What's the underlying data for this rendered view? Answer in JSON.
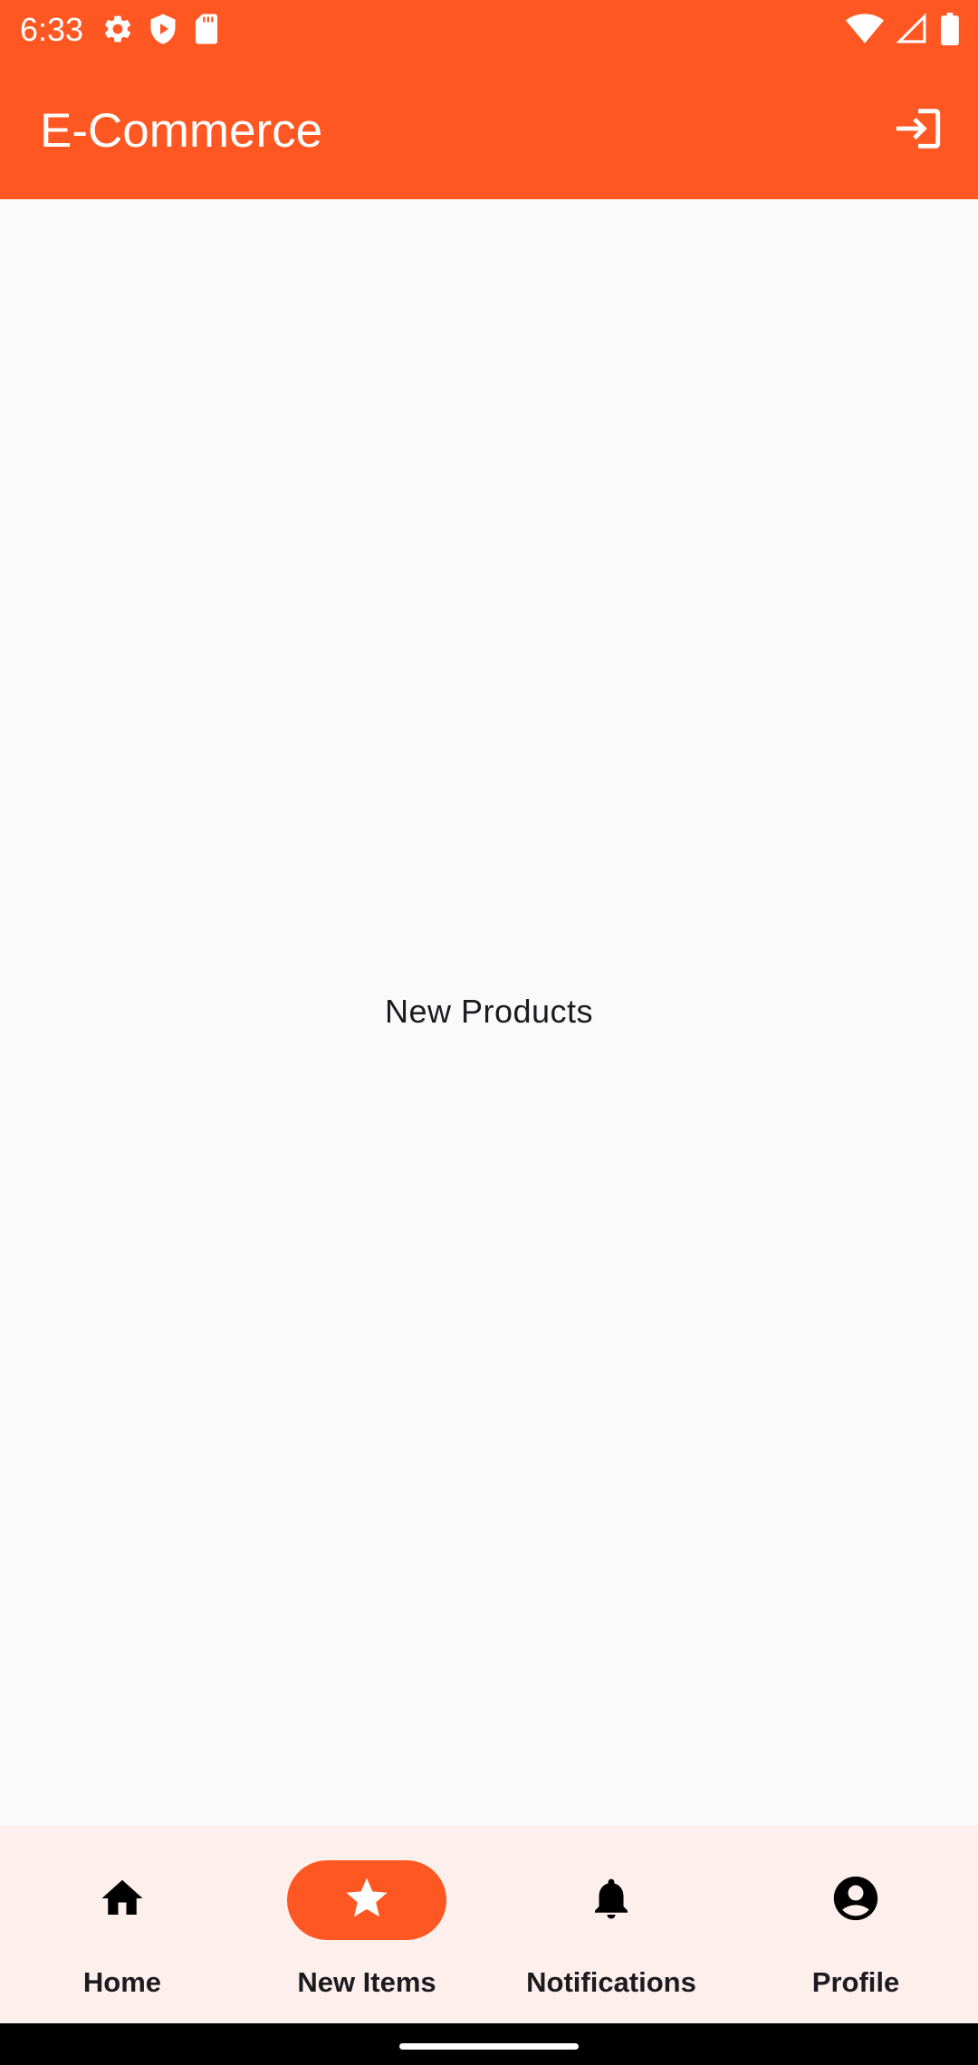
{
  "status_bar": {
    "time": "6:33",
    "left_icons": [
      "settings-icon",
      "shield-play-icon",
      "sd-card-icon"
    ],
    "right_icons": [
      "wifi-icon",
      "cellular-signal-icon",
      "battery-icon"
    ]
  },
  "app_bar": {
    "title": "E-Commerce",
    "action_icon": "login-icon"
  },
  "content": {
    "text": "New Products"
  },
  "bottom_nav": {
    "items": [
      {
        "label": "Home",
        "icon": "home-icon",
        "active": false
      },
      {
        "label": "New Items",
        "icon": "star-icon",
        "active": true
      },
      {
        "label": "Notifications",
        "icon": "bell-icon",
        "active": false
      },
      {
        "label": "Profile",
        "icon": "account-circle-icon",
        "active": false
      }
    ]
  },
  "colors": {
    "primary": "#ff5722",
    "background": "#fafafa",
    "nav_background": "#fdf0ec",
    "text": "#1c1b1f"
  }
}
